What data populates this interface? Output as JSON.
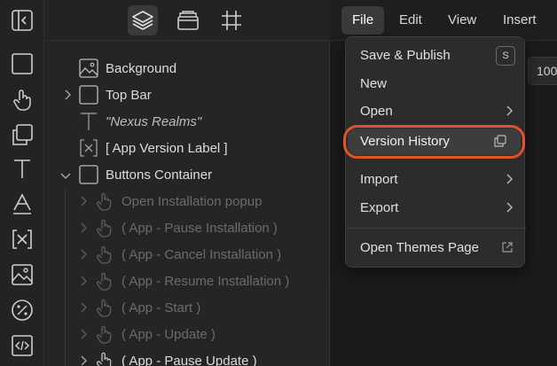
{
  "toolbar": {
    "tabs": [
      {
        "name": "layers-icon",
        "active": true
      },
      {
        "name": "assets-icon",
        "active": false
      },
      {
        "name": "frame-icon",
        "active": false
      }
    ]
  },
  "left_tools": [
    "collapse-panel-icon",
    "rectangle-icon",
    "touch-icon",
    "duplicate-icon",
    "text-icon",
    "text-style-icon",
    "variable-icon",
    "image-icon",
    "percent-icon",
    "code-icon"
  ],
  "layers": [
    {
      "label": "Background",
      "icon": "image-icon",
      "level": 0,
      "chevron": "none",
      "dim": false
    },
    {
      "label": "Top Bar",
      "icon": "container-icon",
      "level": 0,
      "chevron": "right",
      "dim": false
    },
    {
      "label": "\"Nexus Realms\"",
      "icon": "text-icon",
      "level": 0,
      "chevron": "none",
      "dim": false,
      "italic": true
    },
    {
      "label": "[ App Version Label ]",
      "icon": "variable-icon",
      "level": 0,
      "chevron": "none",
      "dim": false
    },
    {
      "label": "Buttons Container",
      "icon": "container-icon",
      "level": 0,
      "chevron": "down",
      "dim": false
    },
    {
      "label": "Open Installation popup",
      "icon": "touch-icon",
      "level": 1,
      "chevron": "right",
      "dim": true
    },
    {
      "label": "( App - Pause Installation )",
      "icon": "touch-icon",
      "level": 1,
      "chevron": "right",
      "dim": true
    },
    {
      "label": "( App - Cancel Installation )",
      "icon": "touch-icon",
      "level": 1,
      "chevron": "right",
      "dim": true
    },
    {
      "label": "( App - Resume Installation )",
      "icon": "touch-icon",
      "level": 1,
      "chevron": "right",
      "dim": true
    },
    {
      "label": "( App - Start )",
      "icon": "touch-icon",
      "level": 1,
      "chevron": "right",
      "dim": true
    },
    {
      "label": "( App - Update )",
      "icon": "touch-icon",
      "level": 1,
      "chevron": "right",
      "dim": true
    },
    {
      "label": "( App - Pause Update )",
      "icon": "touch-icon",
      "level": 1,
      "chevron": "right",
      "dim": false
    }
  ],
  "menubar": {
    "items": [
      "File",
      "Edit",
      "View",
      "Insert"
    ],
    "open": "File"
  },
  "zoom": {
    "value": "100"
  },
  "file_menu": {
    "save_publish": "Save & Publish",
    "save_publish_shortcut": "S",
    "new": "New",
    "open": "Open",
    "version_history": "Version History",
    "import": "Import",
    "export": "Export",
    "open_themes": "Open Themes Page"
  },
  "colors": {
    "highlight_ring": "#e4522a",
    "background": "#1e1e1e"
  }
}
